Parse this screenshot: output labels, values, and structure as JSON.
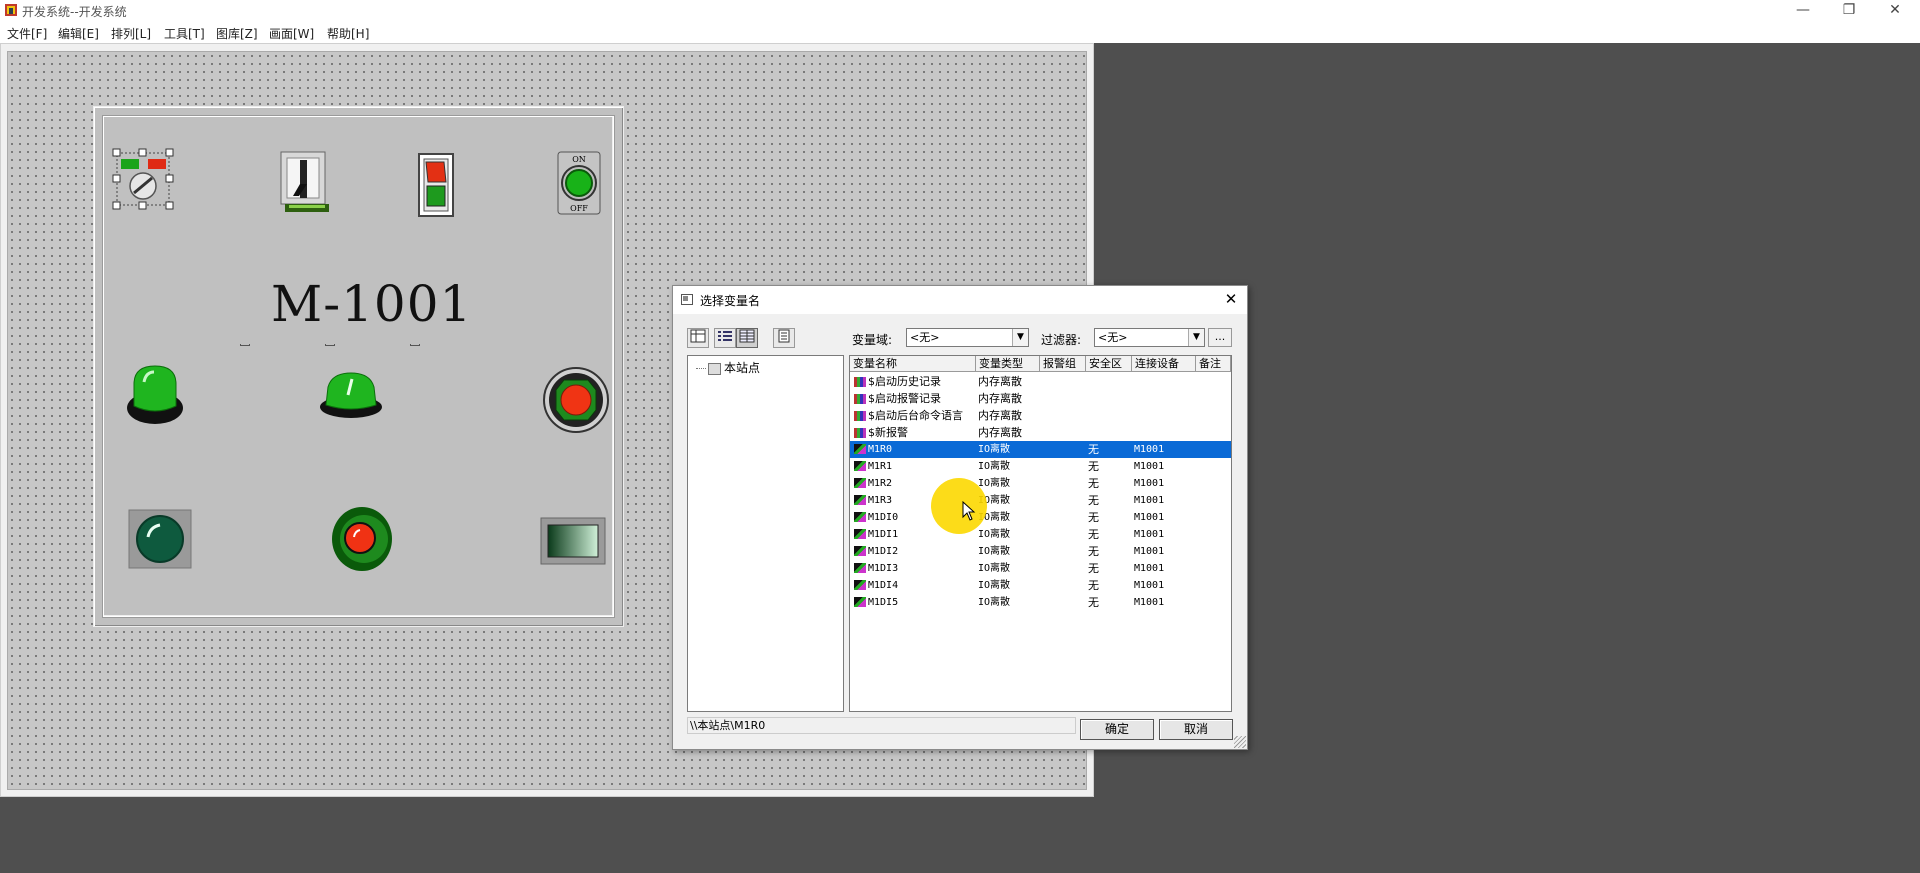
{
  "window": {
    "title": "开发系统--开发系统",
    "controls": [
      "—",
      "❐",
      "✕"
    ]
  },
  "menu": [
    "文件[F]",
    "编辑[E]",
    "排列[L]",
    "工具[T]",
    "图库[Z]",
    "画面[W]",
    "帮助[H]"
  ],
  "canvas": {
    "motor_label": "M-1001",
    "switch_on_label": "ON",
    "switch_off_label": "OFF"
  },
  "dialog": {
    "title": "选择变量名",
    "close": "✕",
    "domain_label": "变量域:",
    "domain_value": "<无>",
    "filter_label": "过滤器:",
    "filter_value": "<无>",
    "more_button": "...",
    "tree_root": "本站点",
    "columns": [
      "变量名称",
      "变量类型",
      "报警组",
      "安全区",
      "连接设备",
      "备注"
    ],
    "rows": [
      {
        "name": "$启动历史记录",
        "type": "内存离散",
        "group": "",
        "zone": "",
        "device": "",
        "icon": "mem"
      },
      {
        "name": "$启动报警记录",
        "type": "内存离散",
        "group": "",
        "zone": "",
        "device": "",
        "icon": "mem"
      },
      {
        "name": "$启动后台命令语言",
        "type": "内存离散",
        "group": "",
        "zone": "",
        "device": "",
        "icon": "mem"
      },
      {
        "name": "$新报警",
        "type": "内存离散",
        "group": "",
        "zone": "",
        "device": "",
        "icon": "mem"
      },
      {
        "name": "M1R0",
        "type": "IO离散",
        "group": "",
        "zone": "无",
        "device": "M1001",
        "icon": "io",
        "selected": true
      },
      {
        "name": "M1R1",
        "type": "IO离散",
        "group": "",
        "zone": "无",
        "device": "M1001",
        "icon": "io"
      },
      {
        "name": "M1R2",
        "type": "IO离散",
        "group": "",
        "zone": "无",
        "device": "M1001",
        "icon": "io"
      },
      {
        "name": "M1R3",
        "type": "IO离散",
        "group": "",
        "zone": "无",
        "device": "M1001",
        "icon": "io"
      },
      {
        "name": "M1DI0",
        "type": "IO离散",
        "group": "",
        "zone": "无",
        "device": "M1001",
        "icon": "io"
      },
      {
        "name": "M1DI1",
        "type": "IO离散",
        "group": "",
        "zone": "无",
        "device": "M1001",
        "icon": "io"
      },
      {
        "name": "M1DI2",
        "type": "IO离散",
        "group": "",
        "zone": "无",
        "device": "M1001",
        "icon": "io"
      },
      {
        "name": "M1DI3",
        "type": "IO离散",
        "group": "",
        "zone": "无",
        "device": "M1001",
        "icon": "io"
      },
      {
        "name": "M1DI4",
        "type": "IO离散",
        "group": "",
        "zone": "无",
        "device": "M1001",
        "icon": "io"
      },
      {
        "name": "M1DI5",
        "type": "IO离散",
        "group": "",
        "zone": "无",
        "device": "M1001",
        "icon": "io"
      }
    ],
    "path": "\\\\本站点\\M1R0",
    "ok": "确定",
    "cancel": "取消"
  },
  "colors": {
    "selection": "#0a6ad6",
    "canvas": "#c7c7c7",
    "desktop": "#4f4f4f",
    "cursor_highlight": "#fcd800"
  }
}
